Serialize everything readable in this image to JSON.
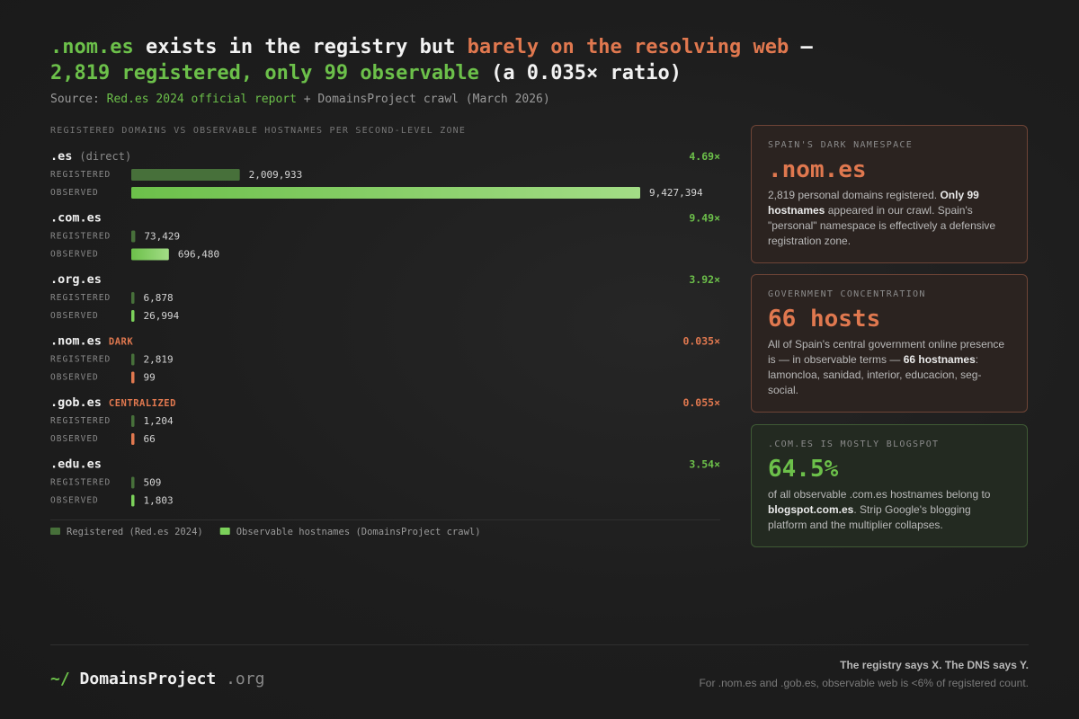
{
  "headline": {
    "l1_a": ".nom.es",
    "l1_b": " exists in the registry but ",
    "l1_c": "barely on the resolving web",
    "l1_d": " —",
    "l2_a": "2,819 registered, only 99 observable",
    "l2_b": " (a 0.035× ratio)"
  },
  "source": {
    "prefix": "Source: ",
    "highlight": "Red.es 2024 official report",
    "suffix": " + DomainsProject crawl (March 2026)"
  },
  "chart_heading": "REGISTERED DOMAINS VS OBSERVABLE HOSTNAMES PER SECOND-LEVEL ZONE",
  "chart_data": {
    "type": "bar",
    "orientation": "horizontal",
    "title": "REGISTERED DOMAINS VS OBSERVABLE HOSTNAMES PER SECOND-LEVEL ZONE",
    "row_labels": [
      "REGISTERED",
      "OBSERVED"
    ],
    "zones": [
      {
        "name": ".es",
        "suffix": "(direct)",
        "tag": "",
        "registered": 2009933,
        "registered_label": "2,009,933",
        "observed": 9427394,
        "observed_label": "9,427,394",
        "ratio": "4.69×",
        "ratio_color": "#6cc04a"
      },
      {
        "name": ".com.es",
        "suffix": "",
        "tag": "",
        "registered": 73429,
        "registered_label": "73,429",
        "observed": 696480,
        "observed_label": "696,480",
        "ratio": "9.49×",
        "ratio_color": "#6cc04a"
      },
      {
        "name": ".org.es",
        "suffix": "",
        "tag": "",
        "registered": 6878,
        "registered_label": "6,878",
        "observed": 26994,
        "observed_label": "26,994",
        "ratio": "3.92×",
        "ratio_color": "#6cc04a"
      },
      {
        "name": ".nom.es",
        "suffix": "",
        "tag": "DARK",
        "registered": 2819,
        "registered_label": "2,819",
        "observed": 99,
        "observed_label": "99",
        "ratio": "0.035×",
        "ratio_color": "#e0784f"
      },
      {
        "name": ".gob.es",
        "suffix": "",
        "tag": "CENTRALIZED",
        "registered": 1204,
        "registered_label": "1,204",
        "observed": 66,
        "observed_label": "66",
        "ratio": "0.055×",
        "ratio_color": "#e0784f"
      },
      {
        "name": ".edu.es",
        "suffix": "",
        "tag": "",
        "registered": 509,
        "registered_label": "509",
        "observed": 1803,
        "observed_label": "1,803",
        "ratio": "3.54×",
        "ratio_color": "#6cc04a"
      }
    ],
    "legend": [
      {
        "label": "Registered (Red.es 2024)",
        "color": "#47703a"
      },
      {
        "label": "Observable hostnames (DomainsProject crawl)",
        "color": "#7bd15a"
      }
    ],
    "colors": {
      "registered": "#47703a",
      "observed": "#7bd15a",
      "observed_dark": "#e0784f"
    }
  },
  "cards": [
    {
      "kicker": "SPAIN'S DARK NAMESPACE",
      "big": ".nom.es",
      "b1": "2,819 personal domains registered. ",
      "b2": "Only 99 hostnames",
      "b3": " appeared in our crawl. Spain's \"personal\" namespace is effectively a defensive registration zone."
    },
    {
      "kicker": "GOVERNMENT CONCENTRATION",
      "big": "66 hosts",
      "b1": "All of Spain's central government online presence is — in observable terms — ",
      "b2": "66 hostnames",
      "b3": ": lamoncloa, sanidad, interior, educacion, seg-social."
    },
    {
      "kicker": ".COM.ES IS MOSTLY BLOGSPOT",
      "big": "64.5%",
      "b1": "of all observable .com.es hostnames belong to ",
      "b2": "blogspot.com.es",
      "b3": ". Strip Google's blogging platform and the multiplier collapses."
    }
  ],
  "footer": {
    "tilde": "~/",
    "brand": "DomainsProject",
    "tld": ".org",
    "line1": "The registry says X. The DNS says Y.",
    "line2": "For .nom.es and .gob.es, observable web is <6% of registered count."
  }
}
